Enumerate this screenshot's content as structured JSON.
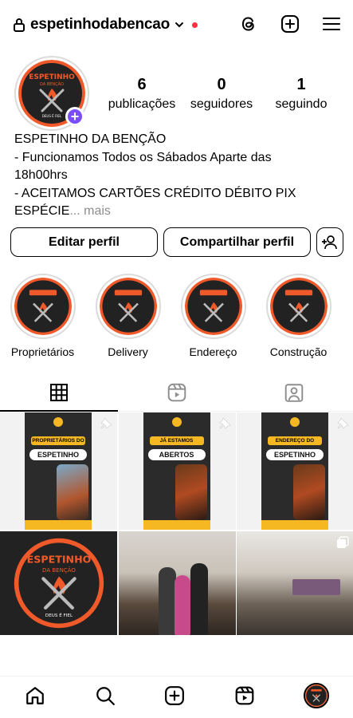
{
  "header": {
    "username": "espetinhodabencao",
    "icons": [
      "lock-icon",
      "chevron-down-icon",
      "threads-icon",
      "create-post-icon",
      "menu-icon"
    ]
  },
  "profile": {
    "stats": [
      {
        "value": "6",
        "label": "publicações"
      },
      {
        "value": "0",
        "label": "seguidores"
      },
      {
        "value": "1",
        "label": "seguindo"
      }
    ],
    "bio": {
      "line1": "ESPETINHO DA BENÇÃO",
      "line2": "- Funcionamos Todos os Sábados Aparte das",
      "line3": "18h00hrs",
      "line4": "- ACEITAMOS CARTÕES CRÉDITO DÉBITO PIX",
      "line5": "ESPÉCIE",
      "ellipsis": "...",
      "more": " mais"
    },
    "logo": {
      "brand": "ESPETINHO",
      "sub": "DA BENÇÃO",
      "tag": "DEUS É FIEL"
    }
  },
  "actions": {
    "edit": "Editar perfil",
    "share": "Compartilhar perfil"
  },
  "highlights": [
    {
      "label": "Proprietários"
    },
    {
      "label": "Delivery"
    },
    {
      "label": "Endereço"
    },
    {
      "label": "Construção"
    }
  ],
  "tabs": [
    "grid-icon",
    "reels-icon",
    "tagged-icon"
  ],
  "posts": {
    "p1": {
      "badge": "PROPRIETÁRIOS DO",
      "title": "ESPETINHO"
    },
    "p2": {
      "badge": "JÁ ESTAMOS",
      "title": "ABERTOS"
    },
    "p3": {
      "badge": "ENDEREÇO DO",
      "title": "ESPETINHO"
    }
  },
  "colors": {
    "accent": "#7a4dff",
    "notification": "#ff3040",
    "poster_yellow": "#f5b823",
    "poster_dark": "#2b2b2b",
    "logo_orange": "#f0592a"
  }
}
